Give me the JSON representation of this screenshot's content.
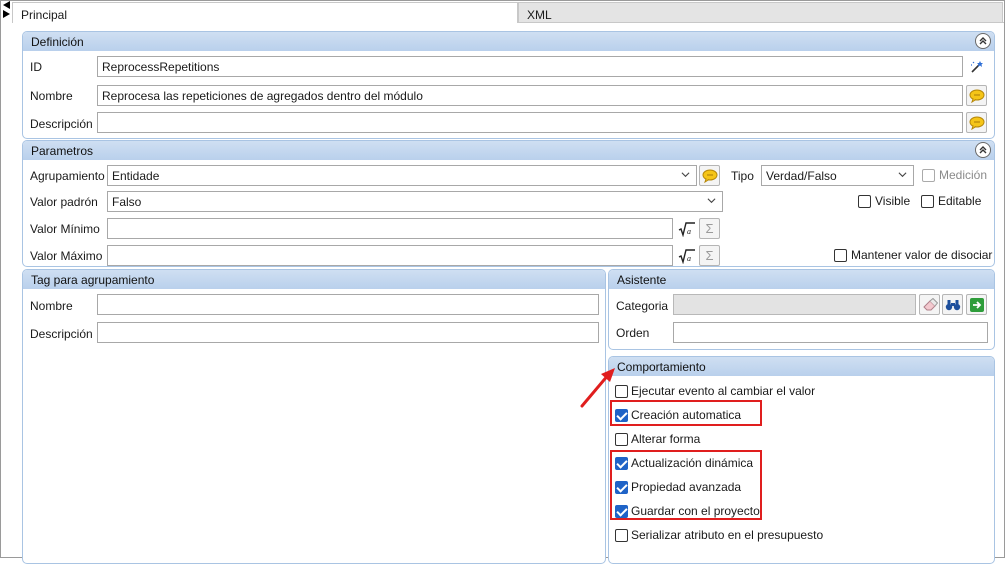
{
  "tabs": {
    "principal": "Principal",
    "xml": "XML"
  },
  "definicion": {
    "title": "Definición",
    "id_label": "ID",
    "id_value": "ReprocessRepetitions",
    "nombre_label": "Nombre",
    "nombre_value": "Reprocesa las repeticiones de agregados dentro del módulo",
    "descripcion_label": "Descripción",
    "descripcion_value": ""
  },
  "parametros": {
    "title": "Parametros",
    "agrupamiento_label": "Agrupamiento",
    "agrupamiento_value": "Entidade",
    "tipo_label": "Tipo",
    "tipo_value": "Verdad/Falso",
    "medicion_label": "Medición",
    "valor_padron_label": "Valor padrón",
    "valor_padron_value": "Falso",
    "visible_label": "Visible",
    "editable_label": "Editable",
    "valor_minimo_label": "Valor Mínimo",
    "valor_minimo_value": "",
    "valor_maximo_label": "Valor Máximo",
    "valor_maximo_value": "",
    "mantener_label": "Mantener valor de disociar",
    "sigma": "Σ"
  },
  "tag": {
    "title": "Tag para agrupamiento",
    "nombre_label": "Nombre",
    "nombre_value": "",
    "descripcion_label": "Descripción",
    "descripcion_value": ""
  },
  "asistente": {
    "title": "Asistente",
    "categoria_label": "Categoria",
    "categoria_value": "",
    "orden_label": "Orden",
    "orden_value": ""
  },
  "comportamiento": {
    "title": "Comportamiento",
    "items": [
      {
        "label": "Ejecutar evento al cambiar el valor",
        "checked": false
      },
      {
        "label": "Creación automatica",
        "checked": true
      },
      {
        "label": "Alterar forma",
        "checked": false
      },
      {
        "label": "Actualización dinámica",
        "checked": true
      },
      {
        "label": "Propiedad avanzada",
        "checked": true
      },
      {
        "label": "Guardar con el proyecto",
        "checked": true
      },
      {
        "label": "Serializar atributo en el presupuesto",
        "checked": false
      }
    ]
  },
  "colors": {
    "accent": "#1f63c7",
    "annotation": "#e01e1e",
    "panel_header": "#c4d7ef"
  }
}
